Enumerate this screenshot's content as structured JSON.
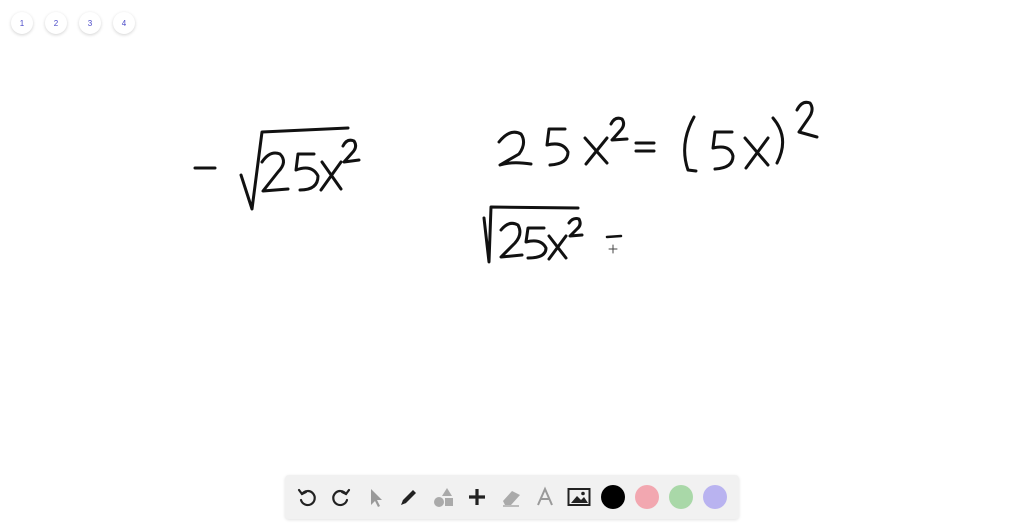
{
  "page_tabs": [
    "1",
    "2",
    "3",
    "4"
  ],
  "toolbar": {
    "tools": [
      "undo-icon",
      "redo-icon",
      "select-pointer-icon",
      "pen-icon",
      "shapes-icon",
      "add-icon",
      "eraser-icon",
      "text-icon",
      "image-icon"
    ],
    "colors": [
      "#000000",
      "#f2a7b0",
      "#a9d8a8",
      "#b9b3f0"
    ]
  }
}
